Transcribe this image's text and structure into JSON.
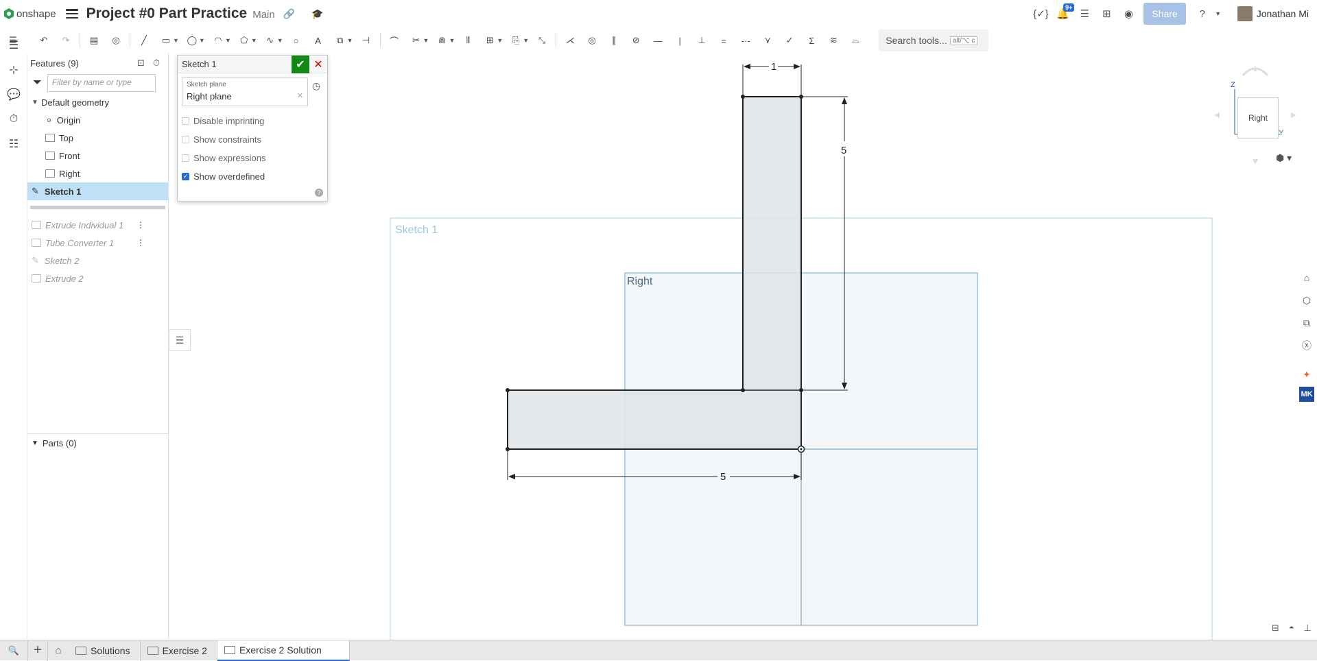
{
  "app": {
    "logo_text": "onshape",
    "doc_title": "Project #0 Part Practice",
    "branch": "Main",
    "notifications_badge": "9+",
    "share_label": "Share",
    "user_name": "Jonathan Mi"
  },
  "toolbar": {
    "search_placeholder": "Search tools...",
    "search_shortcut": "alt/⌥ c"
  },
  "feature_panel": {
    "header": "Features (9)",
    "filter_placeholder": "Filter by name or type",
    "default_geometry": "Default geometry",
    "items": [
      "Origin",
      "Top",
      "Front",
      "Right"
    ],
    "selected": "Sketch 1",
    "rolled_back": [
      "Extrude Individual 1",
      "Tube Converter 1",
      "Sketch 2",
      "Extrude 2"
    ],
    "parts_header": "Parts (0)"
  },
  "sketch_dialog": {
    "title": "Sketch 1",
    "plane_label": "Sketch plane",
    "plane_value": "Right plane",
    "options": [
      {
        "label": "Disable imprinting",
        "checked": false
      },
      {
        "label": "Show constraints",
        "checked": false
      },
      {
        "label": "Show expressions",
        "checked": false
      },
      {
        "label": "Show overdefined",
        "checked": true
      }
    ]
  },
  "canvas": {
    "sketch_label": "Sketch 1",
    "plane_label": "Right",
    "dim_top": "1",
    "dim_right": "5",
    "dim_bottom": "5"
  },
  "viewcube": {
    "face": "Right",
    "axis_z": "Z",
    "axis_y": "Y"
  },
  "tabs": {
    "items": [
      "Solutions",
      "Exercise 2"
    ],
    "active": "Exercise 2 Solution"
  },
  "colors": {
    "accent": "#2a6ad8",
    "ok_green": "#138a13",
    "cancel_red": "#dd0000",
    "selection": "#bfe0f7",
    "plane_fill": "#f3f7f9",
    "plane_stroke": "#9cc4dc",
    "sketch_fill": "#e0e4e8"
  }
}
